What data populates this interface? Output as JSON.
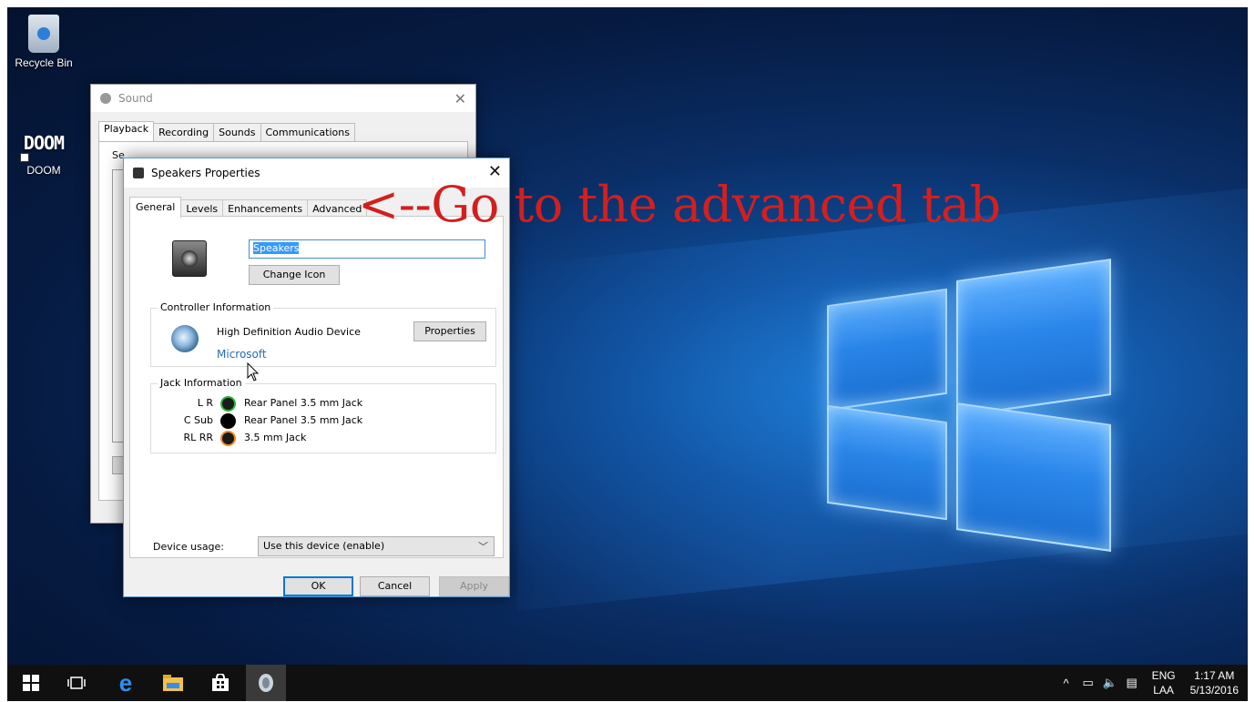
{
  "desktop": {
    "icons": [
      {
        "label": "Recycle Bin",
        "icon": "recycle-bin-icon"
      },
      {
        "label": "DOOM",
        "icon": "doom-icon",
        "logo_text": "DOOM"
      }
    ]
  },
  "sound_window": {
    "title": "Sound",
    "tabs": [
      "Playback",
      "Recording",
      "Sounds",
      "Communications"
    ],
    "active_tab": "Playback",
    "body_text": "Se"
  },
  "speakers_dialog": {
    "title": "Speakers Properties",
    "tabs": [
      "General",
      "Levels",
      "Enhancements",
      "Advanced"
    ],
    "active_tab": "General",
    "device_name": "Speakers",
    "change_icon_label": "Change Icon",
    "controller": {
      "group_title": "Controller Information",
      "name": "High Definition Audio Device",
      "vendor": "Microsoft",
      "properties_label": "Properties"
    },
    "jack": {
      "group_title": "Jack Information",
      "rows": [
        {
          "channel": "L R",
          "description": "Rear Panel 3.5 mm Jack",
          "color": "#27b43a"
        },
        {
          "channel": "C Sub",
          "description": "Rear Panel 3.5 mm Jack",
          "color": "#000000"
        },
        {
          "channel": "RL RR",
          "description": "3.5 mm Jack",
          "color": "#f08a24"
        }
      ]
    },
    "device_usage_label": "Device usage:",
    "device_usage_value": "Use this device (enable)",
    "ok_label": "OK",
    "cancel_label": "Cancel",
    "apply_label": "Apply"
  },
  "annotation": {
    "text": "<--Go to the advanced tab",
    "color": "#d21f1f"
  },
  "taskbar": {
    "pinned": [
      "start-icon",
      "task-view-icon",
      "edge-icon",
      "file-explorer-icon",
      "store-icon",
      "sound-app-icon"
    ],
    "tray": {
      "icons": [
        "chevron-up-icon",
        "network-icon",
        "volume-icon",
        "action-center-icon"
      ],
      "lang_top": "ENG",
      "lang_bottom": "LAA",
      "time": "1:17 AM",
      "date": "5/13/2016"
    }
  }
}
